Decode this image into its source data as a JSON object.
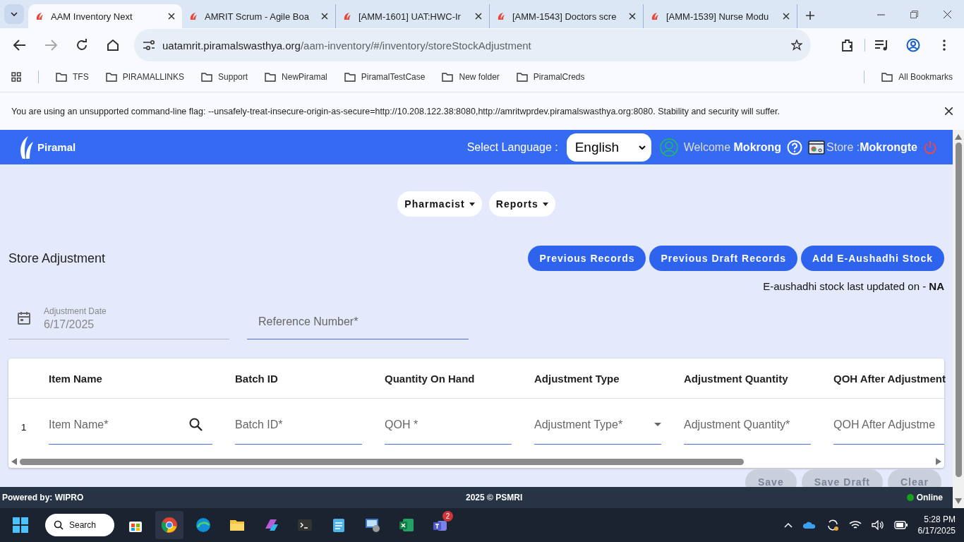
{
  "browser": {
    "tabs": [
      {
        "title": "AAM Inventory Next",
        "selected": true
      },
      {
        "title": "AMRIT Scrum - Agile Boa",
        "selected": false
      },
      {
        "title": "[AMM-1601] UAT:HWC-Ir",
        "selected": false
      },
      {
        "title": "[AMM-1543] Doctors scre",
        "selected": false
      },
      {
        "title": "[AMM-1539] Nurse Modu",
        "selected": false
      }
    ],
    "address_host": "uatamrit.piramalswasthya.org",
    "address_path": "/aam-inventory/#/inventory/storeStockAdjustment",
    "bookmarks": [
      "TFS",
      "PIRAMALLINKS",
      "Support",
      "NewPiramal",
      "PiramalTestCase",
      "New folder",
      "PiramalCreds"
    ],
    "all_bookmarks": "All Bookmarks"
  },
  "infobar": {
    "message": "You are using an unsupported command-line flag: --unsafely-treat-insecure-origin-as-secure=http://10.208.122.38:8080,http://amritwprdev.piramalswasthya.org:8080. Stability and security will suffer."
  },
  "header": {
    "logo": "Piramal",
    "language_label": "Select Language :",
    "language": "English",
    "welcome": "Welcome",
    "user": "Mokrong",
    "store_label": "Store :",
    "store": "Mokrongte"
  },
  "nav_menus": [
    "Pharmacist",
    "Reports"
  ],
  "page": {
    "title": "Store Adjustment",
    "buttons": [
      "Previous Records",
      "Previous Draft Records",
      "Add E-Aushadhi Stock"
    ],
    "note": "E-aushadhi stock last updated on - **NA**",
    "date_label": "Adjustment Date",
    "date_value": "6/17/2025",
    "reference_placeholder": "Reference Number*"
  },
  "table": {
    "columns": [
      "Item Name",
      "Batch ID",
      "Quantity On Hand",
      "Adjustment Type",
      "Adjustment Quantity",
      "QOH After Adjustment"
    ],
    "rows": [
      {
        "number": "1",
        "cells": [
          {
            "kind": "search",
            "placeholder": "Item Name*"
          },
          {
            "kind": "text",
            "placeholder": "Batch ID*"
          },
          {
            "kind": "text",
            "placeholder": "QOH *"
          },
          {
            "kind": "select",
            "placeholder": "Adjustment Type*"
          },
          {
            "kind": "text",
            "placeholder": "Adjustment Quantity*"
          },
          {
            "kind": "text",
            "placeholder": "QOH After Adjustme"
          }
        ]
      }
    ]
  },
  "actions": [
    "Save",
    "Save Draft",
    "Clear"
  ],
  "footer": {
    "powered": "Powered by: WIPRO",
    "copyright": "2025 © PSMRI",
    "status": "Online"
  },
  "taskbar": {
    "search": "Search",
    "badge": "2",
    "time": "5:28 PM",
    "date": "6/17/2025"
  }
}
